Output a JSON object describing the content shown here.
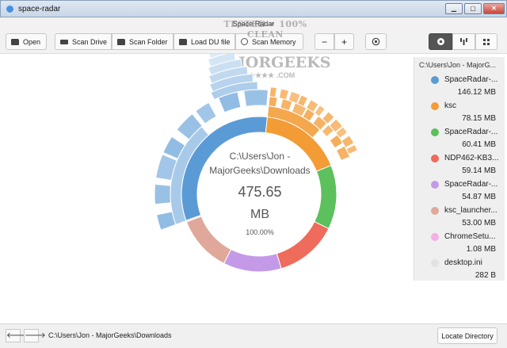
{
  "window": {
    "title": "space-radar",
    "subtitle": "Space Radar",
    "controls": {
      "minimize": "▁",
      "maximize": "▢",
      "close": "✕"
    }
  },
  "toolbar": {
    "open_label": "Open",
    "scan_drive_label": "Scan Drive",
    "scan_folder_label": "Scan Folder",
    "load_du_label": "Load DU file",
    "scan_memory_label": "Scan Memory",
    "zoom_out_label": "−",
    "zoom_in_label": "+",
    "icons": [
      "folder-icon",
      "drive-icon",
      "folder-icon",
      "folder-icon",
      "memory-icon",
      "target-icon",
      "sunburst-icon",
      "flame-icon",
      "treemap-icon"
    ]
  },
  "watermark": {
    "line1": "TESTED • 100% CLEAN",
    "line2": "MAJORGEEKS",
    "line3": "★★★★★★ .COM"
  },
  "sunburst": {
    "center_path": "C:\\Users\\Jon - MajorGeeks\\Downloads",
    "total": "475.65",
    "unit": "MB",
    "percent": "100.00%",
    "segments": [
      {
        "name": "SpaceRadar-...",
        "bytes_mb": 146.12,
        "color": "#5b9bd5"
      },
      {
        "name": "ksc",
        "bytes_mb": 78.15,
        "color": "#f39b35"
      },
      {
        "name": "SpaceRadar-...",
        "bytes_mb": 60.41,
        "color": "#5cc05c"
      },
      {
        "name": "NDP462-KB3...",
        "bytes_mb": 59.14,
        "color": "#ef6b5b"
      },
      {
        "name": "SpaceRadar-...",
        "bytes_mb": 54.87,
        "color": "#c49ae8"
      },
      {
        "name": "ksc_launcher...",
        "bytes_mb": 53.0,
        "color": "#e0a89a"
      },
      {
        "name": "ChromeSetu...",
        "bytes_mb": 1.08,
        "color": "#f4aee8"
      },
      {
        "name": "desktop.ini",
        "bytes_mb": 0.0003,
        "color": "#e2e2e2"
      }
    ]
  },
  "panel": {
    "path": "C:\\Users\\Jon - MajorG...",
    "entries": [
      {
        "name": "SpaceRadar-...",
        "size": "146.12 MB",
        "color": "#5b9bd5"
      },
      {
        "name": "ksc",
        "size": "78.15 MB",
        "color": "#f39b35"
      },
      {
        "name": "SpaceRadar-...",
        "size": "60.41 MB",
        "color": "#5cc05c"
      },
      {
        "name": "NDP462-KB3...",
        "size": "59.14 MB",
        "color": "#ef6b5b"
      },
      {
        "name": "SpaceRadar-...",
        "size": "54.87 MB",
        "color": "#c49ae8"
      },
      {
        "name": "ksc_launcher...",
        "size": "53.00 MB",
        "color": "#e0a89a"
      },
      {
        "name": "ChromeSetu...",
        "size": "1.08 MB",
        "color": "#f4aee8"
      },
      {
        "name": "desktop.ini",
        "size": "282 B",
        "color": "#e2e2e2"
      }
    ]
  },
  "statusbar": {
    "back_label": "🡐",
    "forward_label": "🡒",
    "path": "C:\\Users\\Jon - MajorGeeks\\Downloads",
    "locate_label": "Locate Directory"
  }
}
